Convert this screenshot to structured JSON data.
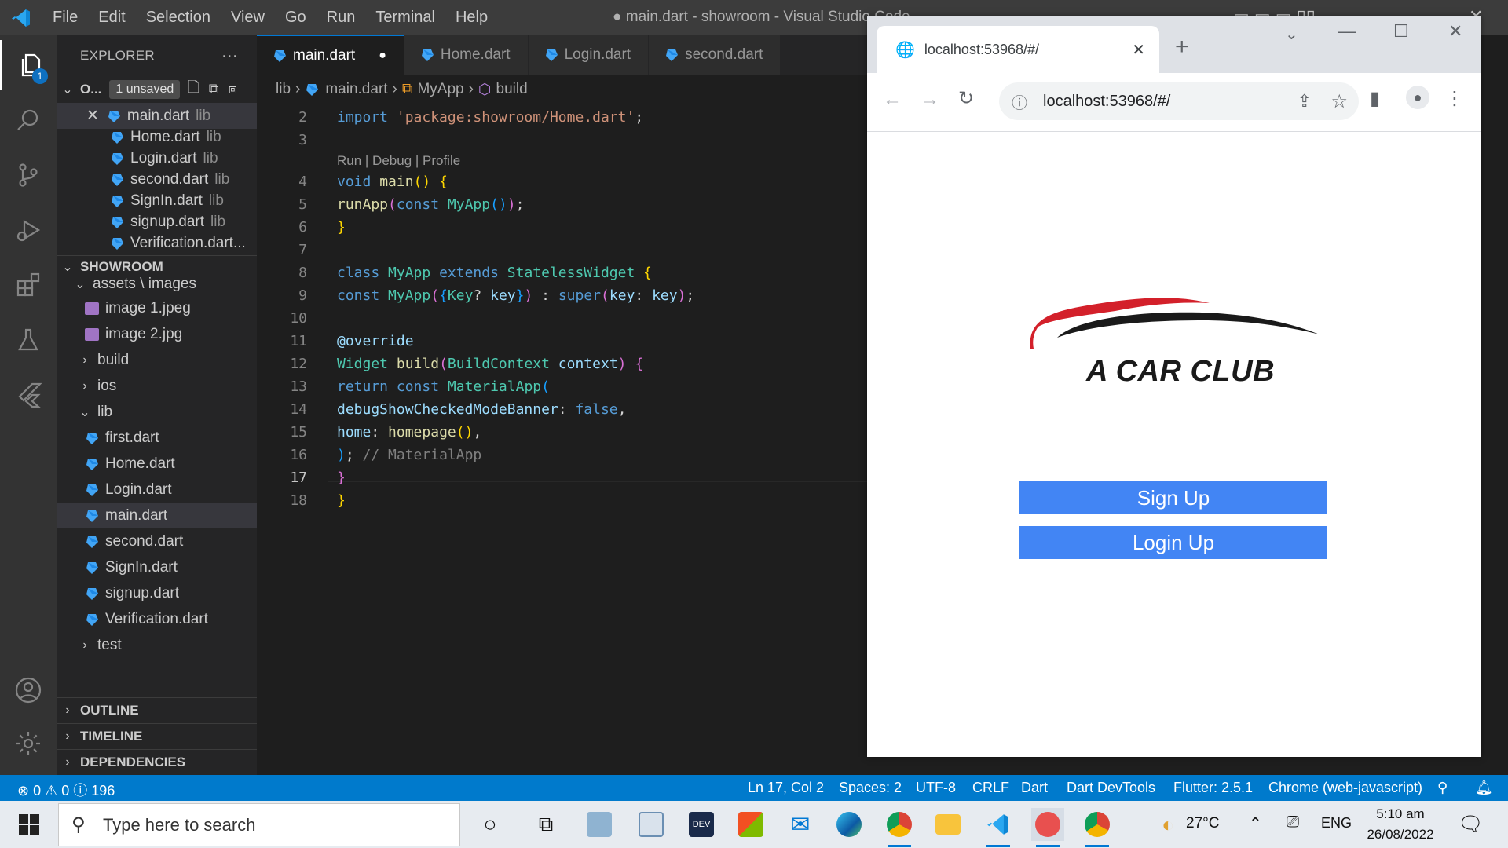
{
  "titlebar": {
    "menu": [
      "File",
      "Edit",
      "Selection",
      "View",
      "Go",
      "Run",
      "Terminal",
      "Help"
    ],
    "window_title": "● main.dart - showroom - Visual Studio Code"
  },
  "activity": {
    "scm_badge": "1"
  },
  "sidebar": {
    "title": "EXPLORER",
    "more": "···",
    "open_editors_label": "O...",
    "unsaved_badge": "1 unsaved",
    "open_editors": [
      {
        "name": "main.dart",
        "dir": "lib"
      },
      {
        "name": "Home.dart",
        "dir": "lib"
      },
      {
        "name": "Login.dart",
        "dir": "lib"
      },
      {
        "name": "second.dart",
        "dir": "lib"
      },
      {
        "name": "SignIn.dart",
        "dir": "lib"
      },
      {
        "name": "signup.dart",
        "dir": "lib"
      },
      {
        "name": "Verification.dart...",
        "dir": ""
      }
    ],
    "project": "SHOWROOM",
    "assets_folder": "assets \\ images",
    "images": [
      "image 1.jpeg",
      "image 2.jpg"
    ],
    "folders": [
      "build",
      "ios",
      "lib"
    ],
    "lib_files": [
      "first.dart",
      "Home.dart",
      "Login.dart",
      "main.dart",
      "second.dart",
      "SignIn.dart",
      "signup.dart",
      "Verification.dart"
    ],
    "test_folder": "test",
    "sections": [
      "OUTLINE",
      "TIMELINE",
      "DEPENDENCIES"
    ]
  },
  "editor": {
    "tabs": [
      "main.dart",
      "Home.dart",
      "Login.dart",
      "second.dart"
    ],
    "breadcrumb": [
      "lib",
      "main.dart",
      "MyApp",
      "build"
    ],
    "codelens": "Run | Debug | Profile"
  },
  "browser": {
    "tab_title": "localhost:53968/#/",
    "url": "localhost:53968/#/",
    "logo_text": "A CAR CLUB",
    "signup_label": "Sign Up",
    "login_label": "Login Up"
  },
  "status": {
    "problems": "⊗ 0 ⚠ 0 ⓘ 196",
    "position": "Ln 17, Col 2",
    "spaces": "Spaces: 2",
    "encoding": "UTF-8",
    "eol": "CRLF",
    "language": "Dart",
    "devtools": "Dart DevTools",
    "flutter": "Flutter: 2.5.1",
    "device": "Chrome (web-javascript)"
  },
  "taskbar": {
    "search_placeholder": "Type here to search",
    "weather": "27°C",
    "lang": "ENG",
    "time": "5:10 am",
    "date": "26/08/2022"
  }
}
